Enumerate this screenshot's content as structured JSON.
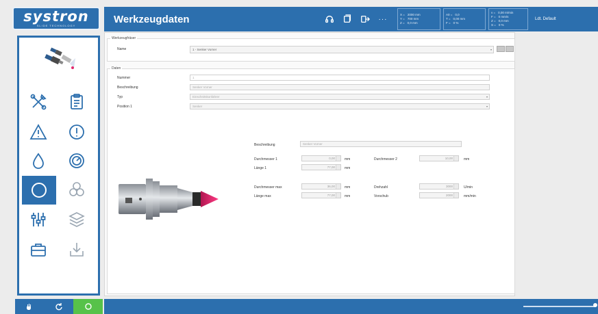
{
  "logo": {
    "name": "systron",
    "tagline": "SLIDE TECHNOLOGY"
  },
  "header": {
    "title": "Werkzeugdaten",
    "icons": [
      "headset-icon",
      "copy-icon",
      "exit-icon",
      "more-icon"
    ],
    "readout1": [
      {
        "axis": "X =",
        "value": "2000 mm"
      },
      {
        "axis": "Y =",
        "value": "700 mm"
      },
      {
        "axis": "Z =",
        "value": "0,0 mm"
      }
    ],
    "readout2": [
      {
        "axis": "A0 =",
        "value": "0,0"
      },
      {
        "axis": "T =",
        "value": "0,00 mm"
      },
      {
        "axis": "F =",
        "value": "0 %"
      }
    ],
    "readout3": [
      {
        "axis": "v =",
        "value": "0,00 m/min"
      },
      {
        "axis": "F =",
        "value": "0 mm/s"
      },
      {
        "axis": "Z =",
        "value": "0,0 mm"
      },
      {
        "axis": "S =",
        "value": "0 %"
      }
    ],
    "unit_button": "Ldt. Default"
  },
  "sidebar": {
    "items": [
      {
        "name": "tools-nav",
        "icon": "wrench-screwdriver-icon",
        "active": false
      },
      {
        "name": "clipboard-nav",
        "icon": "clipboard-icon",
        "active": false
      },
      {
        "name": "warning-nav",
        "icon": "warning-icon",
        "active": false
      },
      {
        "name": "info-nav",
        "icon": "alert-circle-icon",
        "active": false
      },
      {
        "name": "coolant-nav",
        "icon": "drop-icon",
        "active": false
      },
      {
        "name": "gauge-nav",
        "icon": "gauge-icon",
        "active": false
      },
      {
        "name": "tool-data-nav",
        "icon": "circle-icon",
        "active": true
      },
      {
        "name": "triple-circle-nav",
        "icon": "circles-icon",
        "active": false
      },
      {
        "name": "sliders-nav",
        "icon": "sliders-icon",
        "active": false
      },
      {
        "name": "layers-nav",
        "icon": "layers-icon",
        "active": false
      },
      {
        "name": "briefcase-nav",
        "icon": "briefcase-icon",
        "active": false
      },
      {
        "name": "download-nav",
        "icon": "download-icon",
        "active": false
      }
    ]
  },
  "main": {
    "selector_group": {
      "title": "Werkzeugfräser",
      "name_label": "Name",
      "name_value": "1 - Senker Vorner"
    },
    "data_group": {
      "title": "Daten",
      "rows": [
        {
          "label": "Nummer",
          "value": "1"
        },
        {
          "label": "Beschreibung",
          "value": "Senker Vorner"
        },
        {
          "label": "Typ",
          "value": "Einschnitskonfahrer"
        },
        {
          "label": "Position 1",
          "value": "Senker"
        }
      ],
      "detail": {
        "beschreibung_label": "Beschreibung",
        "beschreibung_value": "Senker Vorner",
        "d1_label": "Durchmesser 1",
        "d1_value": "0,00",
        "d1_unit": "mm",
        "l1_label": "Länge 1",
        "l1_value": "77,00",
        "l1_unit": "mm",
        "d2_label": "Durchmesser 2",
        "d2_value": "10,00",
        "d2_unit": "mm",
        "dmax_label": "Durchmesser max",
        "dmax_value": "36,00",
        "dmax_unit": "mm",
        "lmax_label": "Länge max",
        "lmax_value": "77,00",
        "lmax_unit": "mm",
        "drehzahl_label": "Drehzahl",
        "drehzahl_value": "3000",
        "drehzahl_unit": "U/min",
        "vorschub_label": "Vorschub",
        "vorschub_value": "2000",
        "vorschub_unit": "mm/min"
      }
    }
  },
  "colors": {
    "accent": "#2c6fae",
    "active_green": "#57c24a",
    "tool_tip": "#e02a6e"
  }
}
